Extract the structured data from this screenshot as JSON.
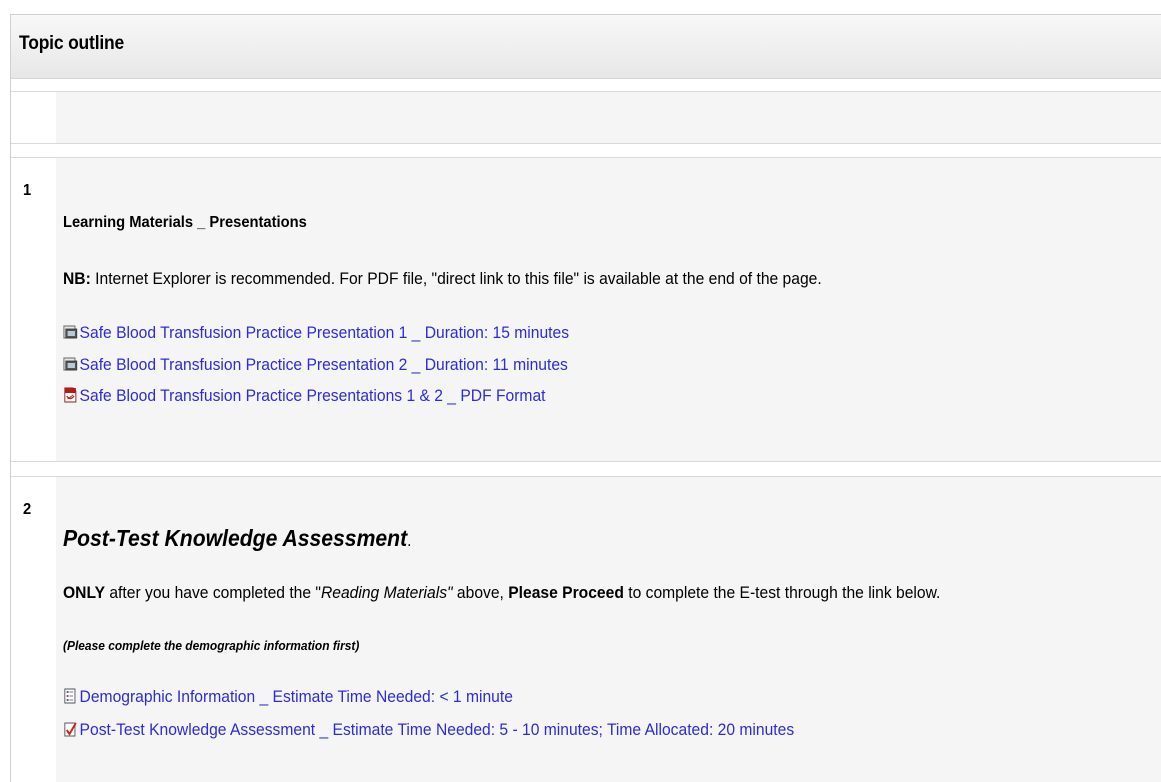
{
  "header": {
    "title": "Topic outline"
  },
  "section1": {
    "number": "1",
    "title": "Learning Materials _ Presentations",
    "note_label": "NB:",
    "note_text": " Internet Explorer is recommended. For PDF file, \"direct link to this file\" is available at the end of the page.",
    "resources": [
      {
        "label": "Safe Blood Transfusion Practice Presentation 1 _ Duration: 15 minutes",
        "icon": "video-file-icon"
      },
      {
        "label": "Safe Blood Transfusion Practice Presentation 2 _ Duration: 11 minutes",
        "icon": "video-file-icon"
      },
      {
        "label": "Safe Blood Transfusion Practice Presentations 1 & 2 _ PDF Format",
        "icon": "pdf-icon"
      }
    ]
  },
  "section2": {
    "number": "2",
    "title": "Post-Test Knowledge Assessment",
    "title_suffix": ".",
    "instr_bold1": "ONLY",
    "instr_text1": " after you have completed the \"",
    "instr_italic": "Reading Materials\"",
    "instr_text2": " above, ",
    "instr_bold2": "Please Proceed",
    "instr_text3": " to complete the E-test through the link below.",
    "note": "(Please complete the demographic information first)",
    "resources": [
      {
        "label": "Demographic Information _ Estimate Time Needed: < 1 minute",
        "icon": "questionnaire-icon"
      },
      {
        "label": "Post-Test Knowledge Assessment _ Estimate Time Needed: 5 - 10 minutes; Time Allocated: 20 minutes",
        "icon": "quiz-icon"
      }
    ]
  }
}
